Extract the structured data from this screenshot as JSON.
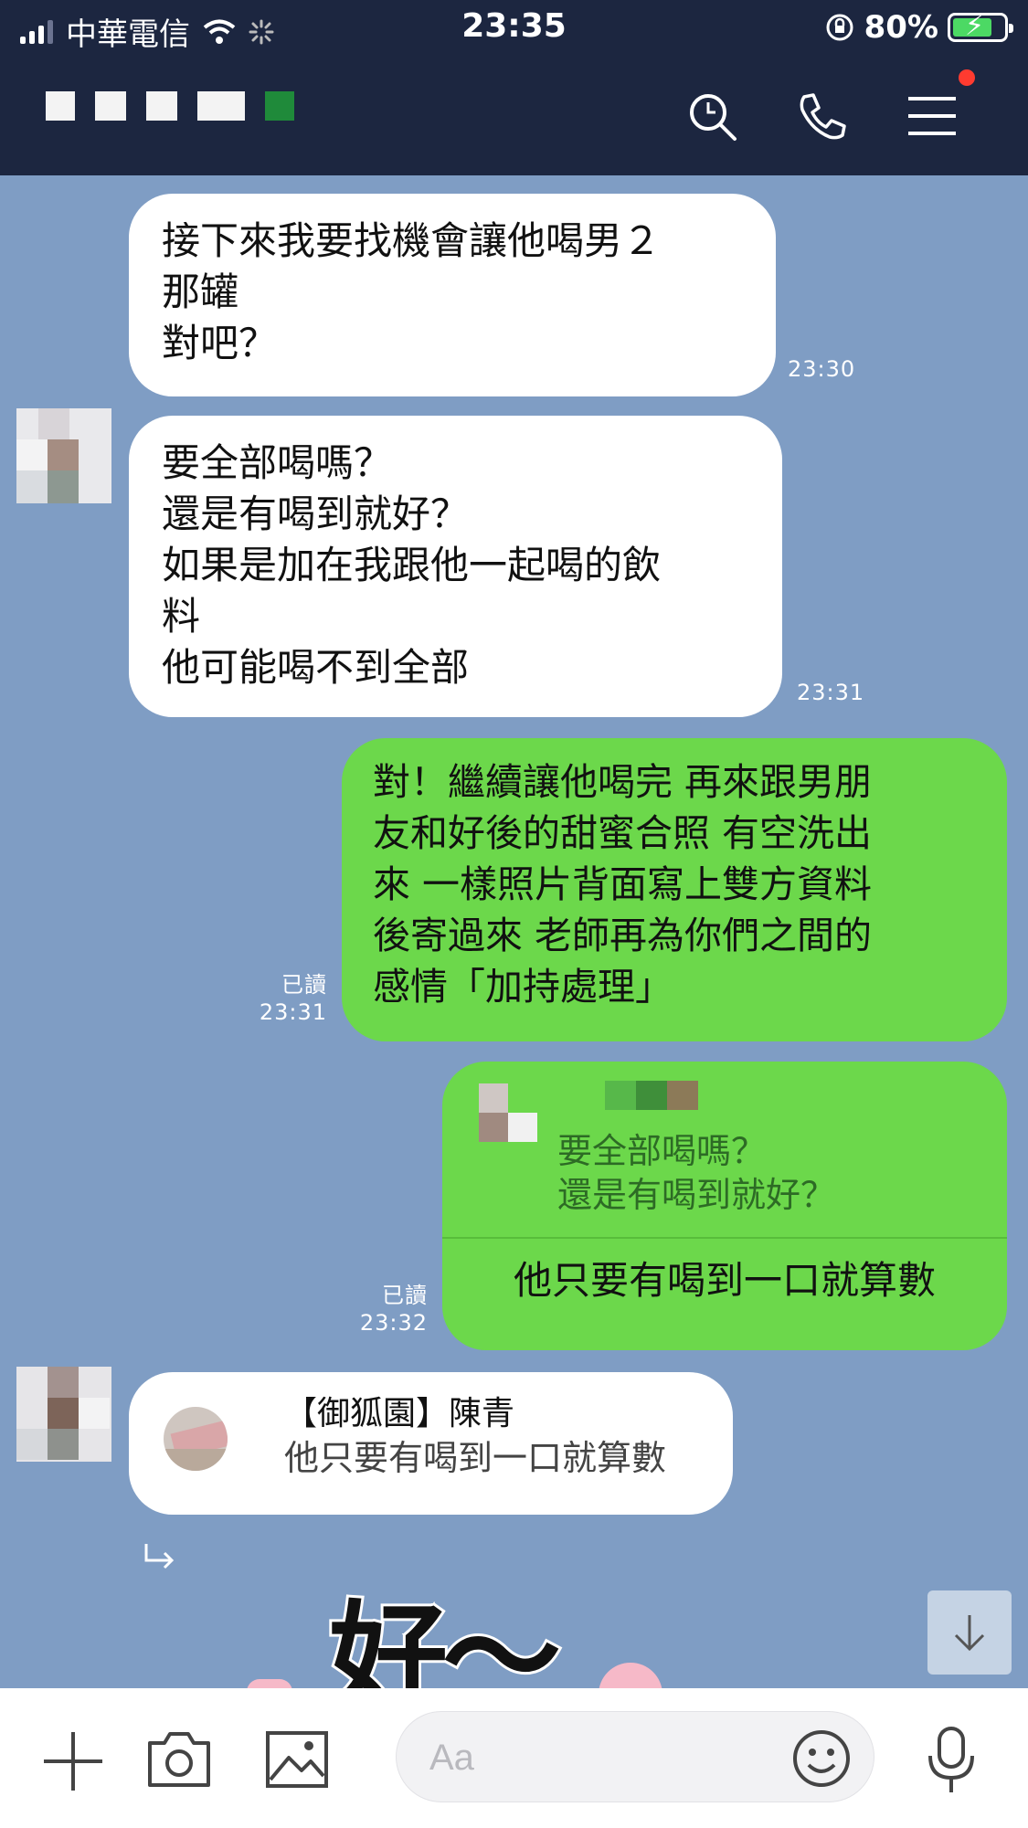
{
  "status_bar": {
    "carrier": "中華電信",
    "time": "23:35",
    "battery": "80%"
  },
  "header": {
    "title": "",
    "icons": [
      "search-icon",
      "phone-icon",
      "menu-icon"
    ]
  },
  "messages": [
    {
      "side": "in",
      "lines": [
        "接下來我要找機會讓他喝男２",
        "那罐",
        "對吧？"
      ],
      "time": "23:30"
    },
    {
      "side": "in",
      "lines": [
        "要全部喝嗎？",
        "還是有喝到就好？",
        "如果是加在我跟他一起喝的飲",
        "料",
        "他可能喝不到全部"
      ],
      "time": "23:31"
    },
    {
      "side": "out",
      "lines": [
        "對！繼續讓他喝完 再來跟男朋",
        "友和好後的甜蜜合照 有空洗出",
        "來 一樣照片背面寫上雙方資料",
        "後寄過來 老師再為你們之間的",
        "感情「加持處理」"
      ],
      "read": "已讀",
      "time": "23:31"
    },
    {
      "side": "out",
      "quote_lines": [
        "要全部喝嗎？",
        "還是有喝到就好？"
      ],
      "text": "他只要有喝到一口就算數",
      "read": "已讀",
      "time": "23:32"
    },
    {
      "side": "in",
      "reply_name": "【御狐園】陳青",
      "reply_text": "他只要有喝到一口就算數"
    }
  ],
  "sticker": {
    "text": "好〜"
  },
  "input": {
    "placeholder": "Aa"
  },
  "colors": {
    "header_bg": "#1c2640",
    "out_bubble": "#6cd84b",
    "in_bubble": "#ffffff",
    "chat_bg": "#7f9dc4"
  }
}
